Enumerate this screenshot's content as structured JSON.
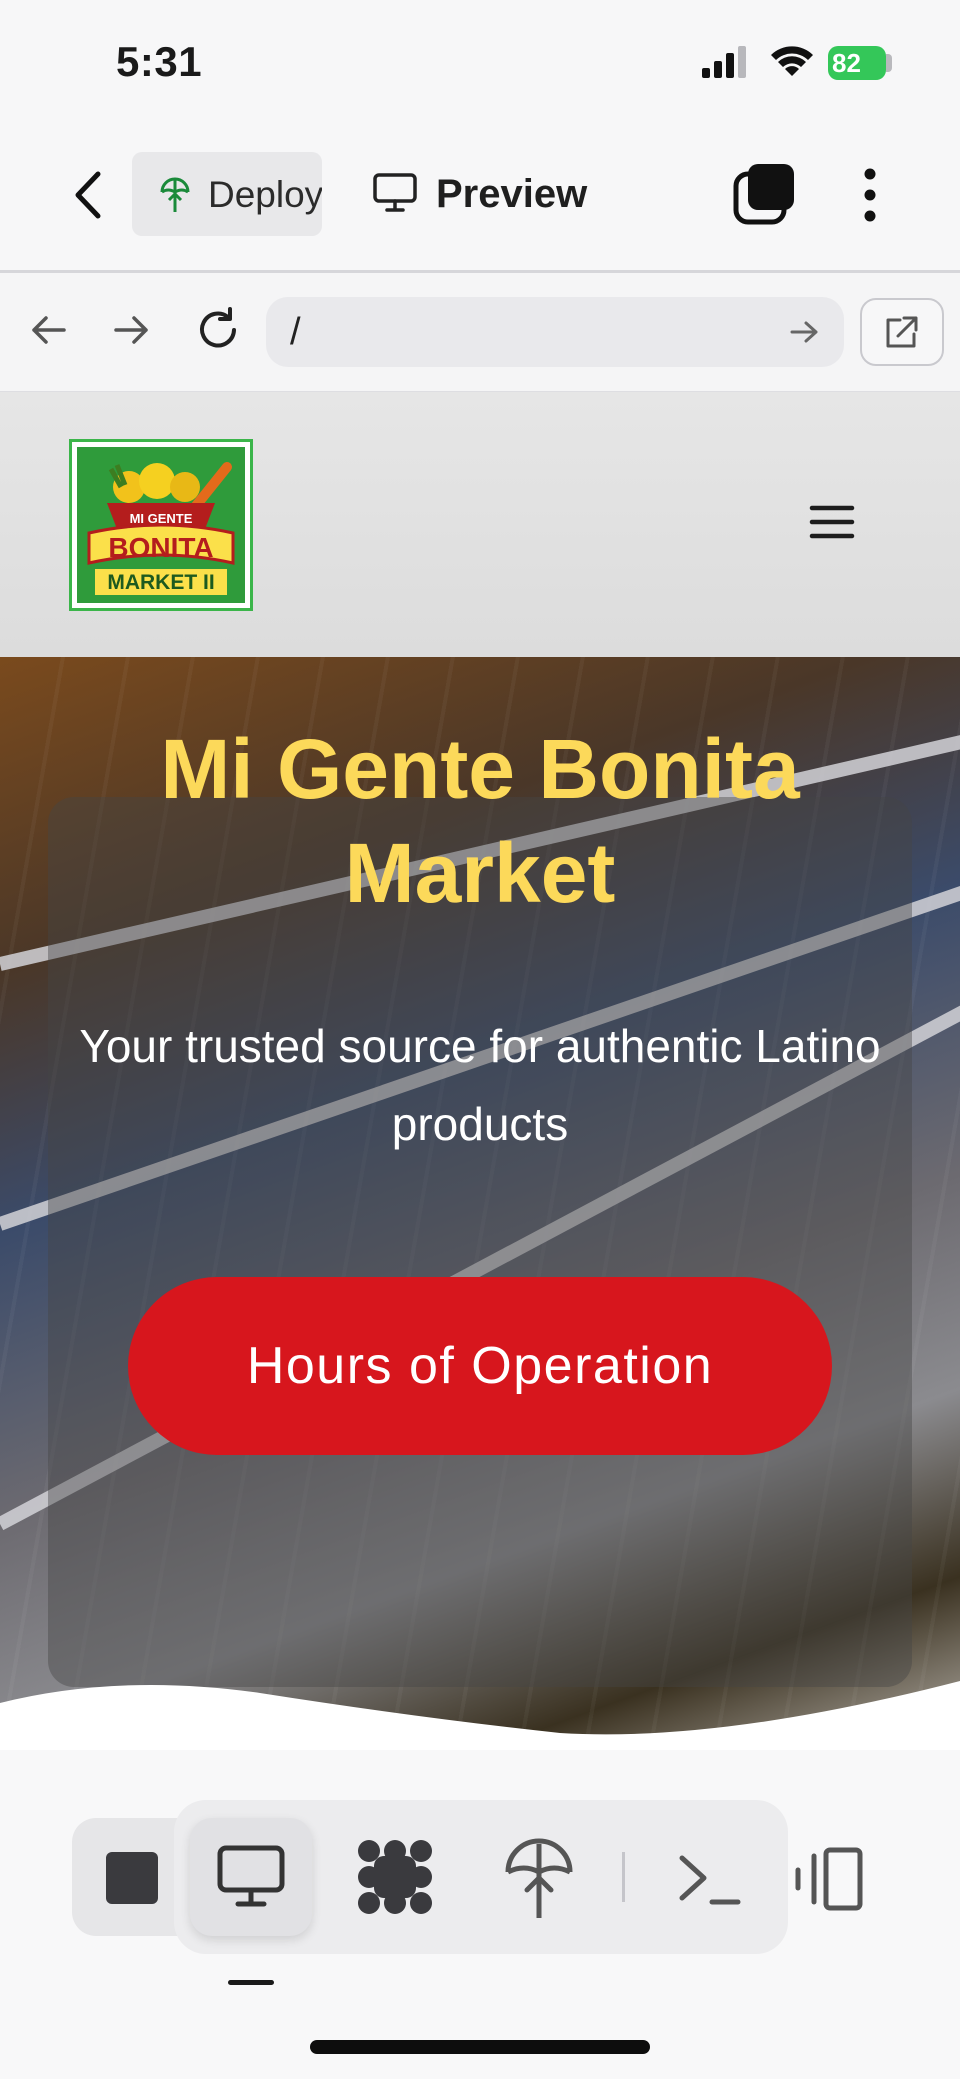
{
  "status_bar": {
    "time": "5:31",
    "battery": "82"
  },
  "toolbar": {
    "deploy_label": "Deploy",
    "preview_label": "Preview"
  },
  "url_bar": {
    "value": "/"
  },
  "site": {
    "logo_text": {
      "line1": "MI GENTE",
      "line2": "BONITA",
      "line3": "MARKET II"
    },
    "hero_title": "Mi Gente Bonita Market",
    "hero_subtitle": "Your trusted source for authentic Latino products",
    "cta_label": "Hours of Operation"
  },
  "colors": {
    "title_yellow": "#fcd95a",
    "cta_red": "#d7161d",
    "battery_green": "#34c759"
  }
}
